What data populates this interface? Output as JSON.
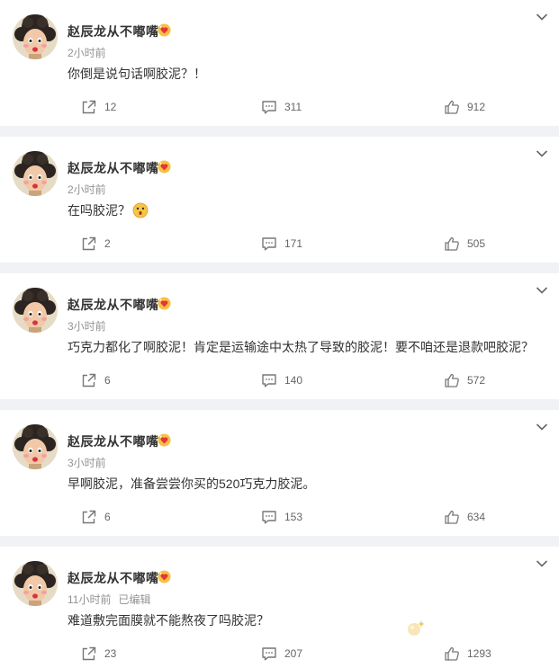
{
  "posts": [
    {
      "username": "赵辰龙从不嘟嘴",
      "time": "2小时前",
      "edited": "",
      "text": "你倒是说句话啊胶泥？！",
      "reposts": "12",
      "comments": "311",
      "likes": "912"
    },
    {
      "username": "赵辰龙从不嘟嘴",
      "time": "2小时前",
      "edited": "",
      "text": "在吗胶泥？",
      "reposts": "2",
      "comments": "171",
      "likes": "505"
    },
    {
      "username": "赵辰龙从不嘟嘴",
      "time": "3小时前",
      "edited": "",
      "text": "巧克力都化了啊胶泥！肯定是运输途中太热了导致的胶泥！要不咱还是退款吧胶泥？",
      "reposts": "6",
      "comments": "140",
      "likes": "572"
    },
    {
      "username": "赵辰龙从不嘟嘴",
      "time": "3小时前",
      "edited": "",
      "text": "早啊胶泥，准备尝尝你买的520巧克力胶泥。",
      "reposts": "6",
      "comments": "153",
      "likes": "634"
    },
    {
      "username": "赵辰龙从不嘟嘴",
      "time": "11小时前",
      "edited": "已编辑",
      "text": "难道敷完面膜就不能熬夜了吗胶泥？",
      "reposts": "23",
      "comments": "207",
      "likes": "1293"
    }
  ],
  "colors": {
    "separator": "#f1f2f5",
    "meta": "#939393",
    "vip_badge": "#f5c243",
    "vip_heart": "#e8323c"
  },
  "icons": {
    "share": "share-icon",
    "comment": "comment-icon",
    "like": "thumbs-up-icon",
    "menu": "chevron-down-icon",
    "badge": "vip-heart-badge-icon"
  }
}
